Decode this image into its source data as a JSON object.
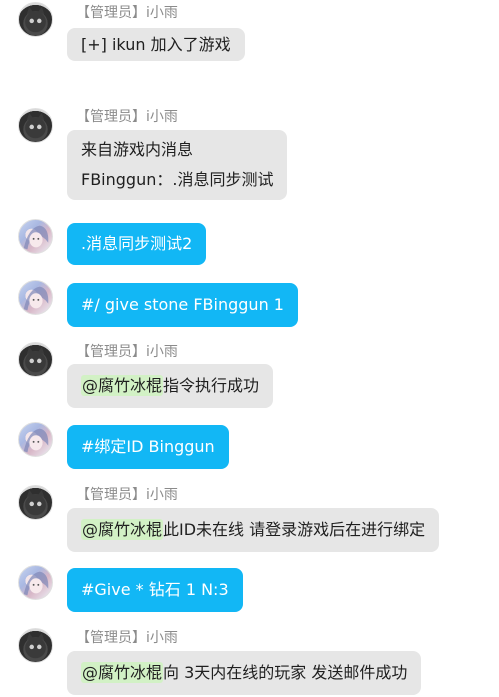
{
  "messages": [
    {
      "sender": "【管理员】i小雨",
      "avatar": "cat-avatar",
      "text": "[+] ikun 加入了游戏"
    },
    {
      "sender": "【管理员】i小雨",
      "avatar": "cat-avatar",
      "line1": "来自游戏内消息",
      "line2": "FBinggun：.消息同步测试"
    },
    {
      "avatar": "anime-avatar",
      "text": ".消息同步测试2"
    },
    {
      "avatar": "anime-avatar",
      "text": "#/ give stone FBinggun 1"
    },
    {
      "sender": "【管理员】i小雨",
      "avatar": "cat-avatar",
      "mention": "@腐竹冰棍",
      "text": "指令执行成功"
    },
    {
      "avatar": "anime-avatar",
      "text": "#绑定ID Binggun"
    },
    {
      "sender": "【管理员】i小雨",
      "avatar": "cat-avatar",
      "mention": "@腐竹冰棍",
      "text": "此ID未在线 请登录游戏后在进行绑定"
    },
    {
      "avatar": "anime-avatar",
      "text": "#Give * 钻石 1 N:3"
    },
    {
      "sender": "【管理员】i小雨",
      "avatar": "cat-avatar",
      "mention": "@腐竹冰棍",
      "text": "向 3天内在线的玩家 发送邮件成功"
    }
  ],
  "colors": {
    "self_bubble": "#12b7f5",
    "other_bubble": "#e6e6e6",
    "mention_bg": "#d2f1c5",
    "sender_text": "#8b8b8b"
  }
}
